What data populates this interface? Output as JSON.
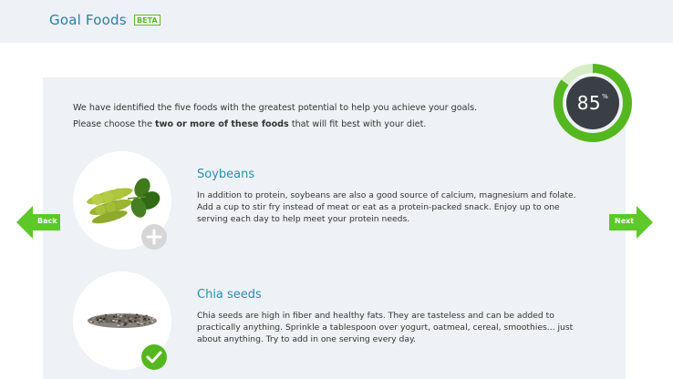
{
  "header": {
    "title": "Goal Foods",
    "badge": "BETA"
  },
  "intro": {
    "line1": "We have identified the five foods with the greatest potential to help you achieve your goals.",
    "line2_prefix": "Please choose the ",
    "line2_bold": "two or more of these foods",
    "line2_suffix": " that will fit best with your diet."
  },
  "progress": {
    "value": "85",
    "symbol": "%",
    "fraction": 0.85,
    "ring_color": "#55b71f",
    "track_color": "#d7ecc7",
    "center_color": "#3a3f45"
  },
  "nav": {
    "back_label": "Back",
    "next_label": "Next",
    "arrow_color": "#5cc82a"
  },
  "foods": [
    {
      "name": "Soybeans",
      "description": "In addition to protein, soybeans are also a good source of calcium, magnesium and folate. Add a cup to stir fry instead of meat or eat as a protein-packed snack. Enjoy up to one serving each day to help meet your protein needs.",
      "selected": false
    },
    {
      "name": "Chia seeds",
      "description": "Chia seeds are high in fiber and healthy fats. They are tasteless and can be added to practically anything. Sprinkle a tablespoon over yogurt, oatmeal, cereal, smoothies... just about anything. Try to add in one serving every day.",
      "selected": true
    }
  ]
}
